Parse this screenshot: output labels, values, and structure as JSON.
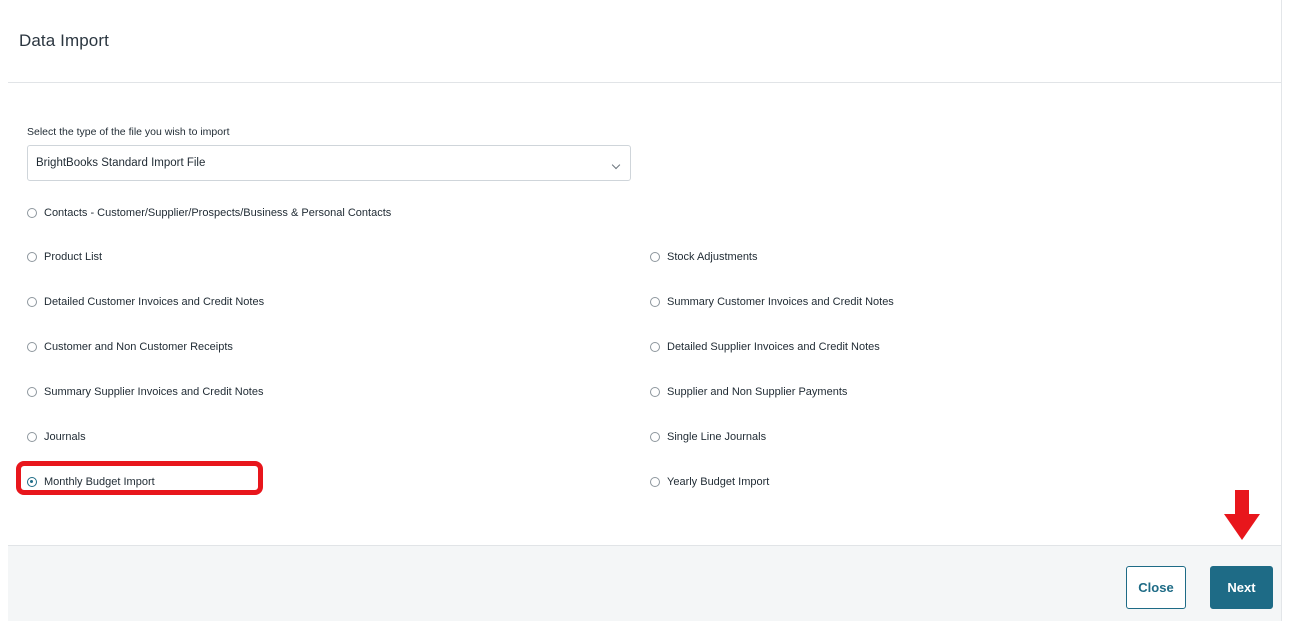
{
  "dialog": {
    "title": "Data Import"
  },
  "file_type": {
    "label": "Select the type of the file you wish to import",
    "selected": "BrightBooks Standard Import File"
  },
  "options": [
    {
      "label": "Contacts - Customer/Supplier/Prospects/Business & Personal Contacts",
      "checked": false
    },
    {
      "label": "Product List",
      "checked": false
    },
    {
      "label": "Stock Adjustments",
      "checked": false
    },
    {
      "label": "Detailed Customer Invoices and Credit Notes",
      "checked": false
    },
    {
      "label": "Summary Customer Invoices and Credit Notes",
      "checked": false
    },
    {
      "label": "Customer and Non Customer Receipts",
      "checked": false
    },
    {
      "label": "Detailed Supplier Invoices and Credit Notes",
      "checked": false
    },
    {
      "label": "Summary Supplier Invoices and Credit Notes",
      "checked": false
    },
    {
      "label": "Supplier and Non Supplier Payments",
      "checked": false
    },
    {
      "label": "Journals",
      "checked": false
    },
    {
      "label": "Single Line Journals",
      "checked": false
    },
    {
      "label": "Monthly Budget Import",
      "checked": true
    },
    {
      "label": "Yearly Budget Import",
      "checked": false
    }
  ],
  "footer": {
    "close_label": "Close",
    "next_label": "Next"
  },
  "colors": {
    "accent": "#1e6b86",
    "annotation": "#e8161c"
  }
}
